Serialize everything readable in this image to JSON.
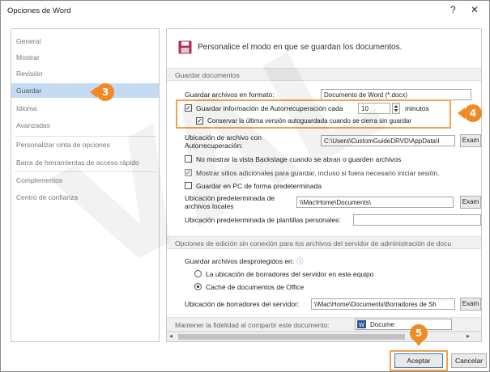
{
  "window": {
    "title": "Opciones de Word",
    "help": "?",
    "close": "✕"
  },
  "sidebar": {
    "items": [
      {
        "label": "General"
      },
      {
        "label": "Mostrar"
      },
      {
        "label": "Revisión"
      },
      {
        "label": "Guardar",
        "active": true
      },
      {
        "label": "Idioma"
      },
      {
        "label": "Avanzadas"
      },
      {
        "label": "Personalizar cinta de opciones"
      },
      {
        "label": "Barra de herramientas de acceso rápido"
      },
      {
        "label": "Complementos"
      },
      {
        "label": "Centro de confianza"
      }
    ]
  },
  "header": {
    "text": "Personalice el modo en que se guardan los documentos."
  },
  "save_section": {
    "title": "Guardar documentos",
    "format_label": "Guardar archivos en formato:",
    "format_value": "Documento de Word (*.docx)",
    "autorecover_label": "Guardar información de Autorrecuperación cada",
    "autorecover_minutes": "10",
    "minutes_label": "minutos",
    "keep_last_label": "Conservar la última versión autoguardada cuando se cierra sin guardar",
    "autorecover_location_label": "Ubicación de archivo con Autorrecuperación:",
    "autorecover_location_value": "C:\\Users\\CustomGuideDRVD\\AppData\\I",
    "browse_label": "Exam",
    "no_backstage_label": "No mostrar la vista Backstage cuando se abran o guarden archivos",
    "show_extra_label": "Mostrar sitios adicionales para guardar, incluso si fuera necesario iniciar sesión.",
    "save_pc_label": "Guardar en PC de forma predeterminada",
    "default_location_label": "Ubicación predeterminada de archivos locales",
    "default_location_value": "\\\\Mac\\Home\\Documents\\",
    "browse2_label": "Exam",
    "template_location_label": "Ubicación predeterminada de plantillas personales:",
    "template_location_value": ""
  },
  "offline_section": {
    "title": "Opciones de edición sin conexión para los archivos del servidor de administración de docu",
    "checked_out_label": "Guardar archivos desprotegidos en:",
    "info_icon": "ⓘ",
    "option1_label": "La ubicación de borradores del servidor en este equipo",
    "option2_label": "Caché de documentos de Office",
    "drafts_label": "Ubicación de borradores del servidor:",
    "drafts_value": "\\\\Mac\\Home\\Documents\\Borradores de Sh",
    "browse3_label": "Exam"
  },
  "fidelity_section": {
    "title": "Mantener la fidelidad al compartir este documento:",
    "doc_value": "Docume"
  },
  "footer": {
    "ok_label": "Aceptar",
    "cancel_label": "Cancelar"
  },
  "callouts": {
    "c3": "3",
    "c4": "4",
    "c5": "5"
  },
  "watermark": "VAL",
  "colors": {
    "accent": "#f08a24",
    "active_nav": "#c5dbf3",
    "save_icon": "#b0305c"
  }
}
